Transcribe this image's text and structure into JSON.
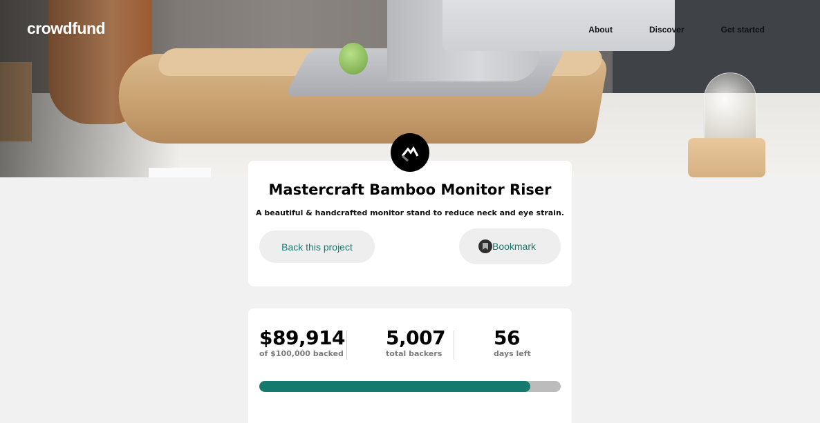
{
  "nav": {
    "logo": "crowdfund",
    "links": [
      "About",
      "Discover",
      "Get started"
    ]
  },
  "project": {
    "logo_icon": "mastercraft-logo-icon",
    "title": "Mastercraft Bamboo Monitor Riser",
    "subtitle": "A beautiful & handcrafted monitor stand to reduce neck and eye strain.",
    "back_label": "Back this project",
    "bookmark_label": "Bookmark",
    "bookmark_icon": "bookmark-icon"
  },
  "stats": {
    "backed_amount": "$89,914",
    "backed_label": "of $100,000 backed",
    "backers": "5,007",
    "backers_label": "total backers",
    "days": "56",
    "days_label": "days left",
    "progress_fraction": 0.89914
  },
  "colors": {
    "accent": "#157a6e",
    "background": "#f1f1f1",
    "progress_track": "#bcbcbc"
  }
}
